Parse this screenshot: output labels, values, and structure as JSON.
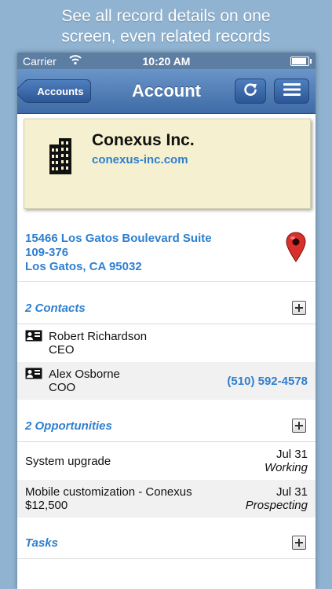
{
  "promo": {
    "line1": "See all record details on one",
    "line2": "screen, even related records"
  },
  "status_bar": {
    "carrier": "Carrier",
    "time": "10:20 AM"
  },
  "nav": {
    "back_label": "Accounts",
    "title": "Account"
  },
  "account": {
    "name": "Conexus Inc.",
    "website": "conexus-inc.com",
    "address_line1": "15466 Los Gatos Boulevard Suite",
    "address_line2": "109-376",
    "address_line3": "Los Gatos, CA 95032"
  },
  "contacts": {
    "header": "2 Contacts",
    "items": [
      {
        "name": "Robert Richardson",
        "title": "CEO",
        "phone": ""
      },
      {
        "name": "Alex Osborne",
        "title": "COO",
        "phone": "(510) 592-4578"
      }
    ]
  },
  "opportunities": {
    "header": "2 Opportunities",
    "items": [
      {
        "name": "System upgrade",
        "amount": "",
        "date": "Jul 31",
        "stage": "Working"
      },
      {
        "name": "Mobile customization - Conexus",
        "amount": "$12,500",
        "date": "Jul 31",
        "stage": "Prospecting"
      }
    ]
  },
  "tasks": {
    "header": "Tasks"
  },
  "colors": {
    "link_blue": "#2f7fcf",
    "nav_blue": "#3e6ba6",
    "card_yellow": "#f5f0cf",
    "pin_red": "#d9302c"
  },
  "icons": [
    "wifi-icon",
    "battery-icon",
    "back-chevron-icon",
    "refresh-icon",
    "menu-icon",
    "building-icon",
    "map-pin-icon",
    "contact-card-icon",
    "plus-icon"
  ]
}
